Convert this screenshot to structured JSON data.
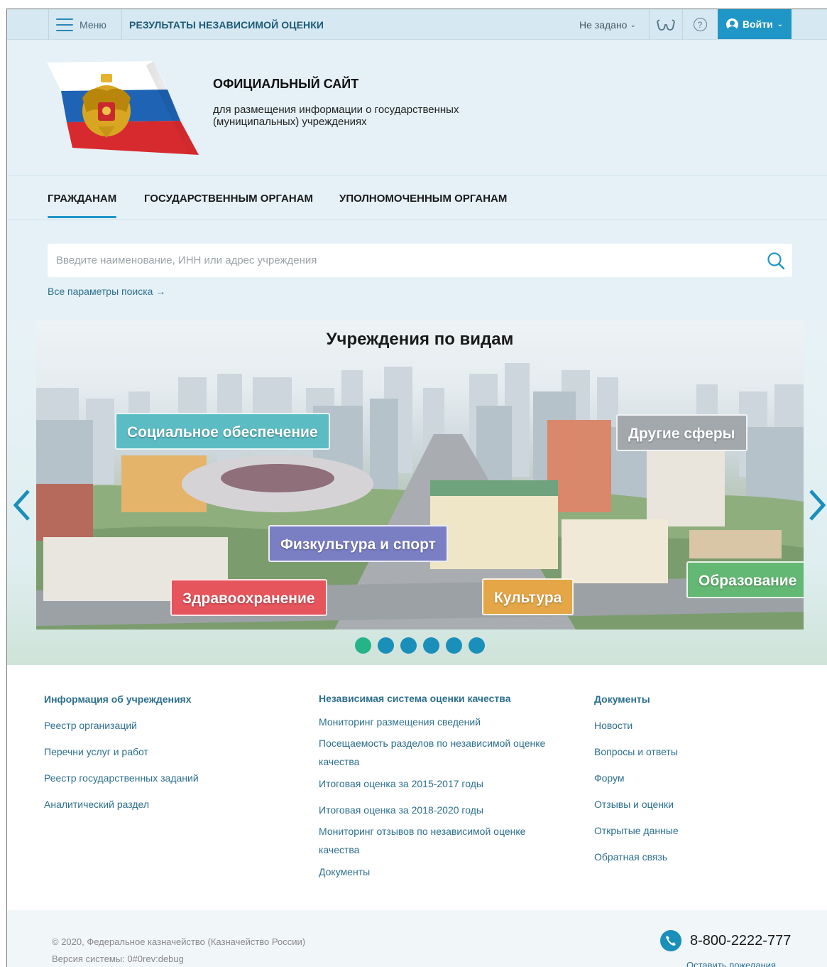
{
  "topbar": {
    "menu_label": "Меню",
    "title": "РЕЗУЛЬТАТЫ НЕЗАВИСИМОЙ ОЦЕНКИ",
    "region_label": "Не задано",
    "login_label": "Войти"
  },
  "header": {
    "site_title": "ОФИЦИАЛЬНЫЙ САЙТ",
    "site_subtitle_line1": "для размещения информации о государственных",
    "site_subtitle_line2": "(муниципальных) учреждениях"
  },
  "nav": {
    "tabs": [
      {
        "label": "ГРАЖДАНАМ",
        "active": true
      },
      {
        "label": "ГОСУДАРСТВЕННЫМ ОРГАНАМ",
        "active": false
      },
      {
        "label": "УПОЛНОМОЧЕННЫМ ОРГАНАМ",
        "active": false
      }
    ]
  },
  "search": {
    "placeholder": "Введите наименование, ИНН или адрес учреждения",
    "value": "",
    "all_params": "Все параметры поиска →"
  },
  "carousel": {
    "title": "Учреждения по видам",
    "categories": [
      {
        "label": "Социальное обеспечение",
        "color": "#5cbcc4"
      },
      {
        "label": "Другие сферы",
        "color": "#a3a8ad"
      },
      {
        "label": "Физкультура и спорт",
        "color": "#7a7ec3"
      },
      {
        "label": "Здравоохранение",
        "color": "#e6545c"
      },
      {
        "label": "Культура",
        "color": "#e4a646"
      },
      {
        "label": "Образование",
        "color": "#63b873"
      }
    ],
    "dots_count": 6,
    "active_dot": 0,
    "accent_color": "#1a8fba",
    "active_dot_color": "#25b489"
  },
  "links": {
    "col1": [
      "Информация об учреждениях",
      "Реестр организаций",
      "Перечни услуг и работ",
      "Реестр государственных заданий",
      "Аналитический раздел"
    ],
    "col2": [
      "Независимая система оценки качества",
      "Мониторинг размещения сведений",
      "Посещаемость разделов по независимой оценке качества",
      "Итоговая оценка за 2015-2017 годы",
      "Итоговая оценка за 2018-2020 годы",
      "Мониторинг отзывов по независимой оценке качества",
      "Документы"
    ],
    "col3": [
      "Документы",
      "Новости",
      "Вопросы и ответы",
      "Форум",
      "Отзывы и оценки",
      "Открытые данные",
      "Обратная связь"
    ]
  },
  "footer": {
    "copyright": "© 2020, Федеральное казначейство (Казначейство России)",
    "version": "Версия системы: 0#0rev:debug",
    "phone": "8-800-2222-777",
    "feedback": "Оставить пожелания"
  },
  "icons": {
    "menu": "hamburger-icon",
    "accessibility": "glasses-icon",
    "help": "question-icon",
    "user": "user-icon",
    "search": "search-icon",
    "phone": "phone-icon",
    "prev": "chevron-left-icon",
    "next": "chevron-right-icon"
  }
}
